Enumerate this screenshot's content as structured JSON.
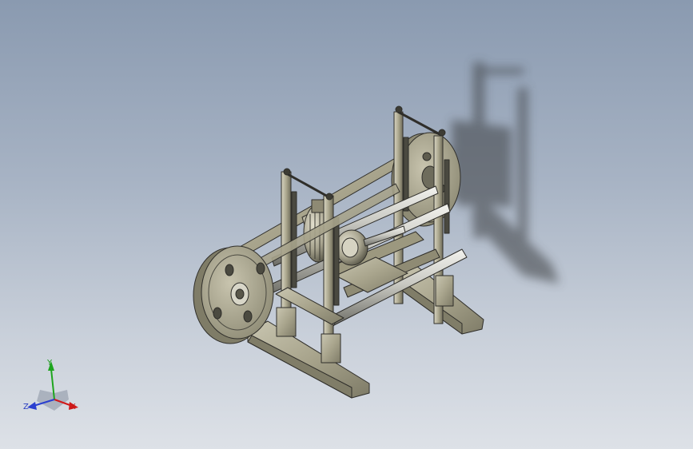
{
  "view": {
    "background_top": "#8a9ab0",
    "background_bottom": "#dde1e7",
    "model_color": "#a7a38c",
    "model_edge_color": "#2f2e2a",
    "shadow_color": "#3a3c40"
  },
  "triad": {
    "x_label": "X",
    "y_label": "Y",
    "z_label": "Z",
    "x_color": "#d11a1a",
    "y_color": "#1ea51e",
    "z_color": "#2a3fd0"
  }
}
